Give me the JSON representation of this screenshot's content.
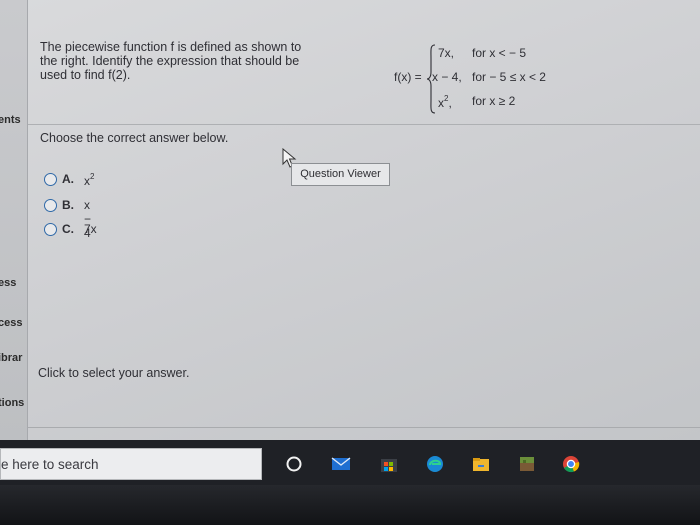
{
  "left_nav": {
    "items": [
      "ents",
      "ess",
      "cess",
      "ibrar",
      "tions"
    ]
  },
  "question": {
    "text_line1": "The piecewise function f is defined as shown to",
    "text_line2": "the right. Identify the expression that should be",
    "text_line3": "used to find f(2)."
  },
  "formula": {
    "lhs": "f(x) =",
    "cases": [
      {
        "expr": "7x,",
        "cond": "for x < − 5"
      },
      {
        "expr": "x − 4,",
        "cond": "for − 5 ≤ x < 2"
      },
      {
        "expr_base": "x",
        "expr_exp": "2",
        "expr_tail": ",",
        "cond": "for x ≥ 2"
      }
    ]
  },
  "instruction": "Choose the correct answer below.",
  "question_viewer_label": "Question Viewer",
  "options": [
    {
      "letter": "A.",
      "base": "x",
      "exp": "2"
    },
    {
      "letter": "B.",
      "value": "x − 4"
    },
    {
      "letter": "C.",
      "value": "7x"
    }
  ],
  "bottom_hint": "Click to select your answer.",
  "taskbar": {
    "search_text": "e here to search",
    "icons": [
      "cortana-icon",
      "mail-icon",
      "store-icon",
      "edge-icon",
      "file-explorer-icon",
      "minecraft-icon",
      "chrome-icon"
    ]
  },
  "colors": {
    "radio_border": "#2f69a8",
    "taskbar": "#1f2126"
  }
}
